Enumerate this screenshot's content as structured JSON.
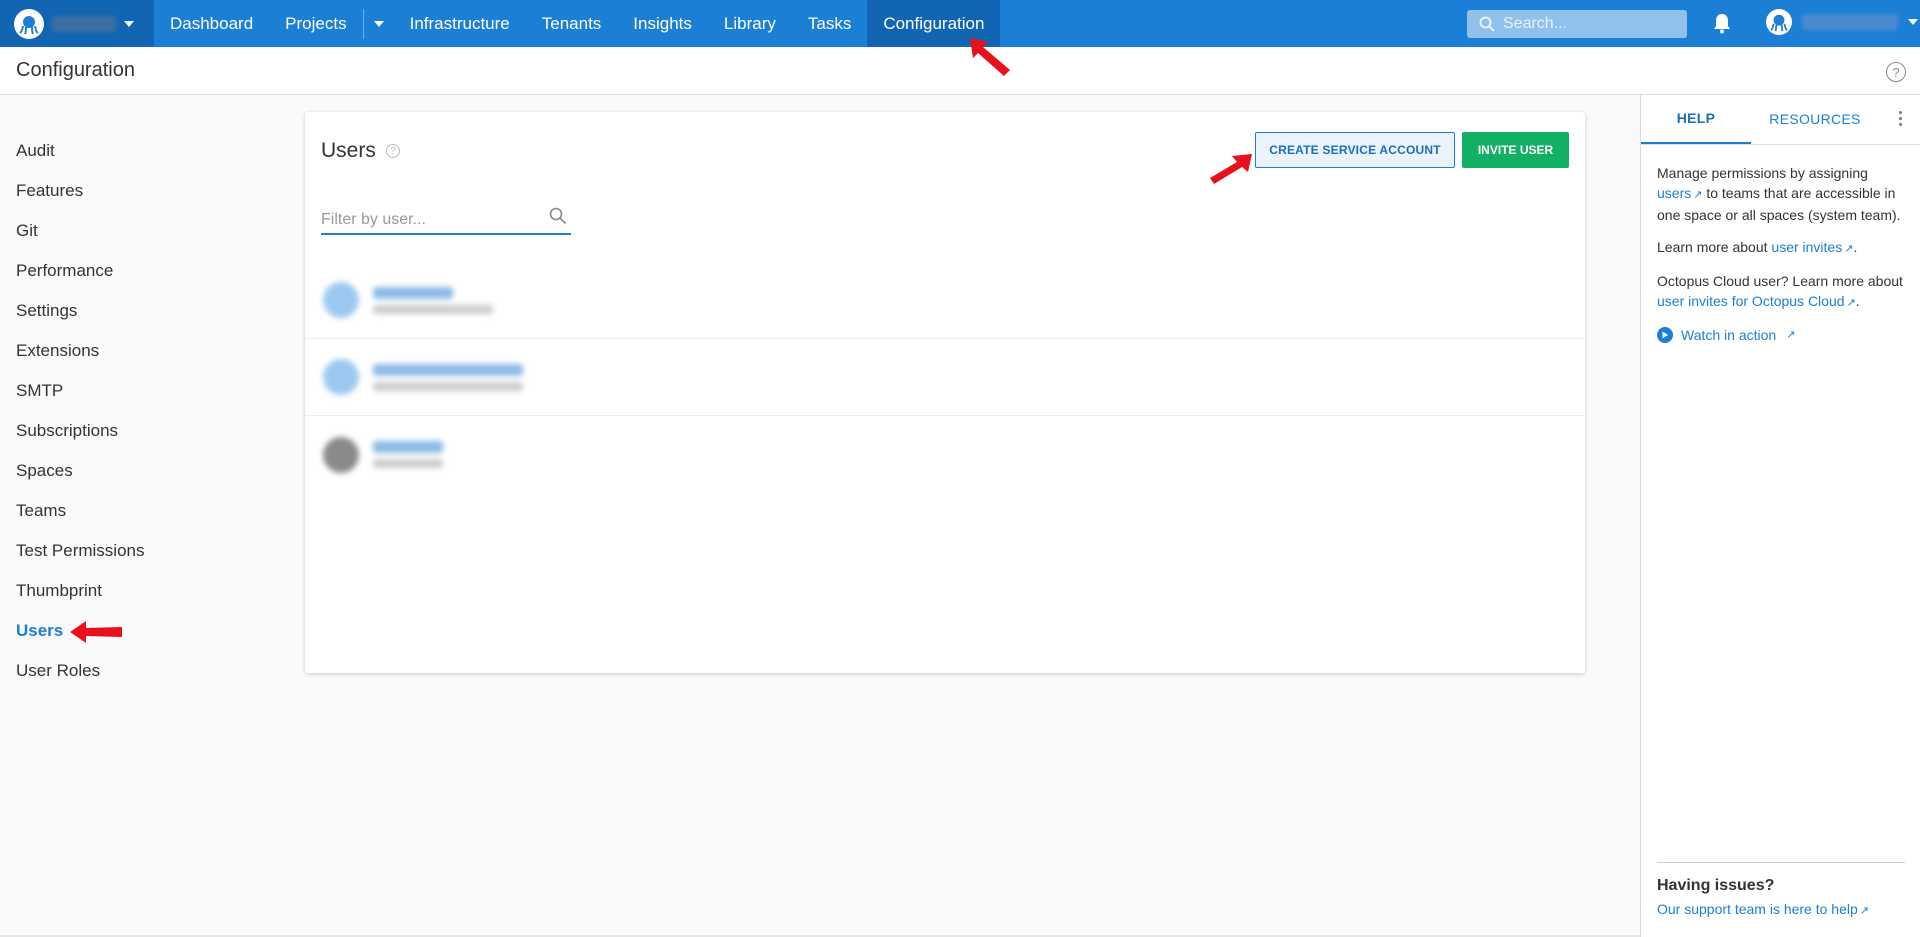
{
  "topnav": {
    "items": [
      {
        "label": "Dashboard"
      },
      {
        "label": "Projects"
      },
      {
        "label": "Infrastructure"
      },
      {
        "label": "Tenants"
      },
      {
        "label": "Insights"
      },
      {
        "label": "Library"
      },
      {
        "label": "Tasks"
      },
      {
        "label": "Configuration"
      }
    ],
    "active": "Configuration",
    "search_placeholder": "Search...",
    "accent": "#1b7fd6"
  },
  "page": {
    "title": "Configuration"
  },
  "sidebar": {
    "items": [
      {
        "label": "Audit"
      },
      {
        "label": "Features"
      },
      {
        "label": "Git"
      },
      {
        "label": "Performance"
      },
      {
        "label": "Settings"
      },
      {
        "label": "Extensions"
      },
      {
        "label": "SMTP"
      },
      {
        "label": "Subscriptions"
      },
      {
        "label": "Spaces"
      },
      {
        "label": "Teams"
      },
      {
        "label": "Test Permissions"
      },
      {
        "label": "Thumbprint"
      },
      {
        "label": "Users"
      },
      {
        "label": "User Roles"
      }
    ],
    "active": "Users"
  },
  "users": {
    "title": "Users",
    "create_service_account_label": "CREATE SERVICE ACCOUNT",
    "invite_user_label": "INVITE USER",
    "filter_placeholder": "Filter by user..."
  },
  "help_panel": {
    "tabs": [
      {
        "label": "HELP"
      },
      {
        "label": "RESOURCES"
      }
    ],
    "p1_before": "Manage permissions by assigning ",
    "p1_link": "users",
    "p1_after": " to teams that are accessible in one space or all spaces (system team).",
    "p2_before": "Learn more about ",
    "p2_link": "user invites",
    "p2_after": ".",
    "p3_before": "Octopus Cloud user? Learn more about ",
    "p3_link": "user invites for Octopus Cloud",
    "p3_after": ".",
    "watch_label": "Watch in action",
    "issues_title": "Having issues?",
    "issues_link": "Our support team is here to help"
  }
}
